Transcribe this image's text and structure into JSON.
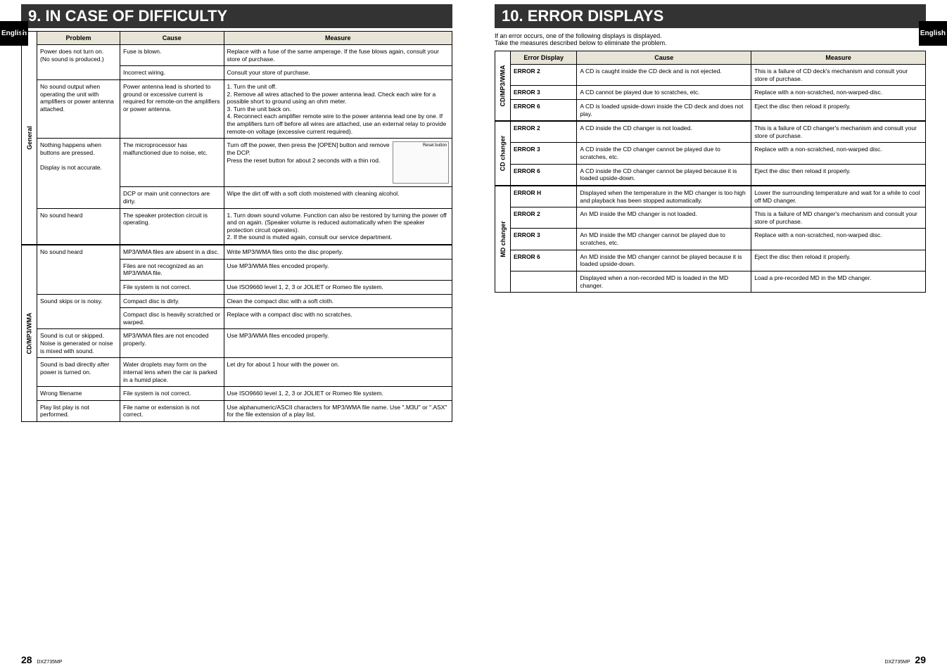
{
  "left_page": {
    "side_tab": "English",
    "title": "9. IN CASE OF DIFFICULTY",
    "headers": {
      "problem": "Problem",
      "cause": "Cause",
      "measure": "Measure"
    },
    "groups": [
      {
        "label": "General",
        "rows": [
          {
            "problem": "Power does not turn on.\n(No sound is produced.)",
            "problem_rowspan": 2,
            "cause": "Fuse is blown.",
            "measure": "Replace with a fuse of the same amperage. If the fuse blows again, consult your store of purchase."
          },
          {
            "cause": "Incorrect wiring.",
            "measure": "Consult your store of purchase."
          },
          {
            "problem": "No sound output when operating the unit with amplifiers or power antenna attached.",
            "cause": "Power antenna lead is shorted to ground or excessive current is required for remote-on the amplifiers or power antenna.",
            "measure": "1. Turn the unit off.\n2. Remove all wires attached to the power antenna lead. Check each wire for a possible short to ground using an ohm meter.\n3. Turn the unit back on.\n4. Reconnect each amplifier remote wire to the power antenna lead one by one. If the amplifiers turn off before all wires are attached, use an external relay to provide remote-on voltage (excessive current required)."
          },
          {
            "problem": "Nothing happens when buttons are pressed.\n\nDisplay is not accurate.",
            "problem_rowspan": 2,
            "cause": "The microprocessor has malfunctioned due to noise, etc.",
            "measure": "Turn off the power, then press the [OPEN] button and remove the DCP.\nPress the reset button for about 2 seconds with a thin rod.",
            "has_image": true,
            "image_label": "Reset button"
          },
          {
            "cause": "DCP or main unit connectors are dirty.",
            "measure": "Wipe the dirt off with a soft cloth moistened with cleaning alcohol."
          },
          {
            "problem": "No sound heard",
            "cause": "The speaker protection circuit is operating.",
            "measure": "1. Turn down sound volume. Function can also be restored by turning the power off and on again. (Speaker volume is reduced automatically when the speaker protection circuit operates).\n2. If the sound is muted again, consult our service department."
          }
        ]
      },
      {
        "label": "CD/MP3/WMA",
        "rows": [
          {
            "problem": "No sound heard",
            "problem_rowspan": 3,
            "cause": "MP3/WMA files are absent in a disc.",
            "measure": "Write MP3/WMA files onto the disc properly."
          },
          {
            "cause": "Files are not recognized as an MP3/WMA file.",
            "measure": "Use MP3/WMA files encoded properly."
          },
          {
            "cause": "File system is not correct.",
            "measure": "Use ISO9660 level 1, 2, 3 or JOLIET or Romeo file system."
          },
          {
            "problem": "Sound skips or is noisy.",
            "problem_rowspan": 2,
            "cause": "Compact disc is dirty.",
            "measure": "Clean the compact disc with a soft cloth."
          },
          {
            "cause": "Compact disc is heavily scratched or warped.",
            "measure": "Replace with a compact disc with no scratches."
          },
          {
            "problem": "Sound is cut or skipped.\nNoise is generated or noise is mixed with sound.",
            "cause": "MP3/WMA files are not encoded properly.",
            "measure": "Use MP3/WMA files encoded properly."
          },
          {
            "problem": "Sound is bad directly after power is turned on.",
            "cause": "Water droplets may form on the internal lens when the car is parked in a humid place.",
            "measure": "Let dry for about 1 hour with the power on."
          },
          {
            "problem": "Wrong filename",
            "cause": "File system is not correct.",
            "measure": "Use ISO9660 level 1, 2, 3 or JOLIET or Romeo file system."
          },
          {
            "problem": "Play list play is not performed.",
            "cause": "File name or extension is not correct.",
            "measure": "Use alphanumeric/ASCII characters for MP3/WMA file name. Use \".M3U\" or \".ASX\" for the file extension of a play list."
          }
        ]
      }
    ],
    "footer": {
      "page": "28",
      "model": "DXZ735MP"
    }
  },
  "right_page": {
    "side_tab": "English",
    "title": "10. ERROR DISPLAYS",
    "intro": "If an error occurs, one of the following displays is displayed.\nTake the measures described below to eliminate the problem.",
    "headers": {
      "error": "Error Display",
      "cause": "Cause",
      "measure": "Measure"
    },
    "groups": [
      {
        "label": "CD/MP3/WMA",
        "rows": [
          {
            "error": "ERROR 2",
            "cause": "A CD is caught inside the CD deck and is not ejected.",
            "measure": "This is a failure of CD deck's mechanism and consult your store of purchase."
          },
          {
            "error": "ERROR 3",
            "cause": "A CD cannot be played due to scratches, etc.",
            "measure": "Replace with a non-scratched, non-warped-disc."
          },
          {
            "error": "ERROR 6",
            "cause": "A CD is loaded upside-down inside the CD deck and does not play.",
            "measure": "Eject the disc then reload it properly."
          }
        ]
      },
      {
        "label": "CD changer",
        "rows": [
          {
            "error": "ERROR 2",
            "cause": "A CD inside the CD changer is not loaded.",
            "measure": "This is a failure of CD changer's mechanism and consult your store of purchase."
          },
          {
            "error": "ERROR 3",
            "cause": "A CD inside the CD changer cannot be played due to scratches, etc.",
            "measure": "Replace with a non-scratched, non-warped disc."
          },
          {
            "error": "ERROR 6",
            "cause": "A CD inside the CD changer cannot be played because it is loaded upside-down.",
            "measure": "Eject the disc then reload it properly."
          }
        ]
      },
      {
        "label": "MD changer",
        "rows": [
          {
            "error": "ERROR H",
            "cause": "Displayed when the temperature in the MD changer is too high and playback has been stopped automatically.",
            "measure": "Lower the surrounding temperature and wait for a while to cool off MD changer."
          },
          {
            "error": "ERROR 2",
            "cause": "An MD inside the MD changer is not loaded.",
            "measure": "This is a failure of MD changer's mechanism and consult your store of purchase."
          },
          {
            "error": "ERROR 3",
            "cause": "An MD inside the MD changer cannot be played due to scratches, etc.",
            "measure": "Replace with a non-scratched, non-warped disc."
          },
          {
            "error": "ERROR 6",
            "cause": "An MD inside the MD changer cannot be played because it is loaded upside-down.",
            "measure": "Eject the disc then reload it properly."
          },
          {
            "error": "",
            "cause": "Displayed when a non-recorded MD is loaded in the MD changer.",
            "measure": "Load a pre-recorded MD in the MD changer."
          }
        ]
      }
    ],
    "footer": {
      "page": "29",
      "model": "DXZ735MP"
    }
  }
}
